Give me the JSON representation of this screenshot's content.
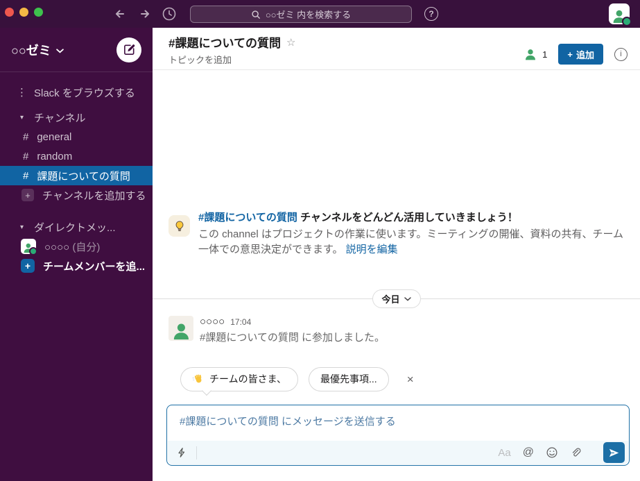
{
  "titlebar": {
    "search_label": "○○ゼミ 内を検索する",
    "help_glyph": "?"
  },
  "sidebar": {
    "workspace": "○○ゼミ",
    "browse": "Slack をブラウズする",
    "browse_glyph": "⋮",
    "section_glyph": "▾",
    "channels_header": "チャンネル",
    "hash": "#",
    "channels": [
      "general",
      "random",
      "課題についての質問"
    ],
    "add_plus": "+",
    "add_channel": "チャンネルを追加する",
    "dm_header": "ダイレクトメッ...",
    "dm_user": "○○○○",
    "dm_user_note": "(自分)",
    "add_member": "チームメンバーを追..."
  },
  "header": {
    "title": "#課題についての質問",
    "star": "☆",
    "topic": "トピックを追加",
    "member_count": "1",
    "add_plus": "+",
    "add_label": "追加",
    "info_glyph": "i"
  },
  "tip": {
    "channel_link": "#課題についての質問",
    "headline": " チャンネルをどんどん活用していきましょう！",
    "body": "この channel はプロジェクトの作業に使います。ミーティングの開催、資料の共有、チーム一体での意思決定ができます。 ",
    "edit_link": "説明を編集"
  },
  "date_divider": {
    "label": "今日"
  },
  "message": {
    "author": "○○○○",
    "time": "17:04",
    "text": "#課題についての質問 に参加しました。"
  },
  "suggestions": {
    "chip1": "チームの皆さま、",
    "chip2": "最優先事項...",
    "close": "×"
  },
  "composer": {
    "placeholder": "#課題についての質問 にメッセージを送信する",
    "format_label": "Aa",
    "at_label": "@"
  },
  "colors": {
    "topbar": "#38113c",
    "sidebar": "#3f0e40",
    "selected_blue": "#1164a3",
    "link_blue": "#1264a3",
    "composer_border": "#1d6fa5",
    "send_button": "#1c6fa6",
    "avatar_green": "#42a568",
    "presence_green": "#2bac76",
    "tip_icon_bg": "#f6efdf"
  }
}
